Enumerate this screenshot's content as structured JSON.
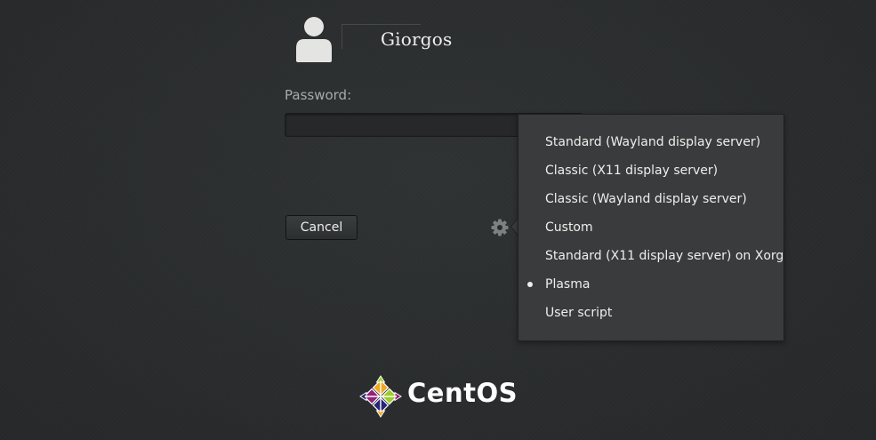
{
  "user": {
    "name": "Giorgos"
  },
  "password": {
    "label": "Password:",
    "value": ""
  },
  "buttons": {
    "cancel_label": "Cancel"
  },
  "session_menu": {
    "items": [
      {
        "label": "Standard (Wayland display server)",
        "selected": false
      },
      {
        "label": "Classic (X11 display server)",
        "selected": false
      },
      {
        "label": "Classic (Wayland display server)",
        "selected": false
      },
      {
        "label": "Custom",
        "selected": false
      },
      {
        "label": "Standard (X11 display server) on Xorg",
        "selected": false
      },
      {
        "label": "Plasma",
        "selected": true
      },
      {
        "label": "User script",
        "selected": false
      }
    ]
  },
  "branding": {
    "logo_text": "CentOS"
  },
  "icons": {
    "avatar": "user-avatar-icon",
    "gear": "gear-icon",
    "logo": "centos-logo-icon"
  },
  "colors": {
    "background": "#2a2c2d",
    "text": "#eeeeec",
    "label": "#a7aba9",
    "menu_bg": "#393b3c",
    "logo_purple": "#932279",
    "logo_yellow": "#efa724",
    "logo_green": "#9ccd2a",
    "logo_blue": "#262577"
  }
}
